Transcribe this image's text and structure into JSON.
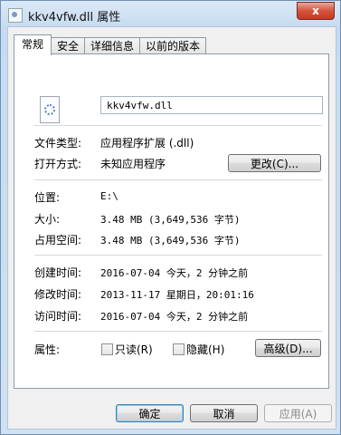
{
  "window": {
    "title": "kkv4vfw.dll 属性",
    "close_label": "x"
  },
  "tabs": [
    "常规",
    "安全",
    "详细信息",
    "以前的版本"
  ],
  "file": {
    "name": "kkv4vfw.dll"
  },
  "type": {
    "label": "文件类型:",
    "value": "应用程序扩展 (.dll)"
  },
  "opens_with": {
    "label": "打开方式:",
    "value": "未知应用程序",
    "change_button": "更改(C)..."
  },
  "location": {
    "label": "位置:",
    "value": "E:\\"
  },
  "size": {
    "label": "大小:",
    "value": "3.48 MB (3,649,536 字节)"
  },
  "size_on_disk": {
    "label": "占用空间:",
    "value": "3.48 MB (3,649,536 字节)"
  },
  "created": {
    "label": "创建时间:",
    "value": "2016-07-04 今天，2 分钟之前"
  },
  "modified": {
    "label": "修改时间:",
    "value": "2013-11-17 星期日，20:01:16"
  },
  "accessed": {
    "label": "访问时间:",
    "value": "2016-07-04 今天，2 分钟之前"
  },
  "attributes": {
    "label": "属性:",
    "readonly": "只读(R)",
    "hidden": "隐藏(H)",
    "advanced_button": "高级(D)..."
  },
  "footer": {
    "ok": "确定",
    "cancel": "取消",
    "apply": "应用(A)"
  }
}
